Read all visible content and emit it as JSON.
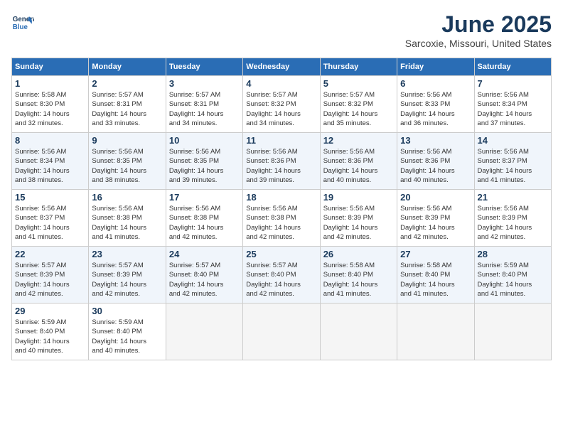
{
  "header": {
    "logo_line1": "General",
    "logo_line2": "Blue",
    "month": "June 2025",
    "location": "Sarcoxie, Missouri, United States"
  },
  "days_of_week": [
    "Sunday",
    "Monday",
    "Tuesday",
    "Wednesday",
    "Thursday",
    "Friday",
    "Saturday"
  ],
  "weeks": [
    [
      {
        "day": "1",
        "info": "Sunrise: 5:58 AM\nSunset: 8:30 PM\nDaylight: 14 hours\nand 32 minutes."
      },
      {
        "day": "2",
        "info": "Sunrise: 5:57 AM\nSunset: 8:31 PM\nDaylight: 14 hours\nand 33 minutes."
      },
      {
        "day": "3",
        "info": "Sunrise: 5:57 AM\nSunset: 8:31 PM\nDaylight: 14 hours\nand 34 minutes."
      },
      {
        "day": "4",
        "info": "Sunrise: 5:57 AM\nSunset: 8:32 PM\nDaylight: 14 hours\nand 34 minutes."
      },
      {
        "day": "5",
        "info": "Sunrise: 5:57 AM\nSunset: 8:32 PM\nDaylight: 14 hours\nand 35 minutes."
      },
      {
        "day": "6",
        "info": "Sunrise: 5:56 AM\nSunset: 8:33 PM\nDaylight: 14 hours\nand 36 minutes."
      },
      {
        "day": "7",
        "info": "Sunrise: 5:56 AM\nSunset: 8:34 PM\nDaylight: 14 hours\nand 37 minutes."
      }
    ],
    [
      {
        "day": "8",
        "info": "Sunrise: 5:56 AM\nSunset: 8:34 PM\nDaylight: 14 hours\nand 38 minutes."
      },
      {
        "day": "9",
        "info": "Sunrise: 5:56 AM\nSunset: 8:35 PM\nDaylight: 14 hours\nand 38 minutes."
      },
      {
        "day": "10",
        "info": "Sunrise: 5:56 AM\nSunset: 8:35 PM\nDaylight: 14 hours\nand 39 minutes."
      },
      {
        "day": "11",
        "info": "Sunrise: 5:56 AM\nSunset: 8:36 PM\nDaylight: 14 hours\nand 39 minutes."
      },
      {
        "day": "12",
        "info": "Sunrise: 5:56 AM\nSunset: 8:36 PM\nDaylight: 14 hours\nand 40 minutes."
      },
      {
        "day": "13",
        "info": "Sunrise: 5:56 AM\nSunset: 8:36 PM\nDaylight: 14 hours\nand 40 minutes."
      },
      {
        "day": "14",
        "info": "Sunrise: 5:56 AM\nSunset: 8:37 PM\nDaylight: 14 hours\nand 41 minutes."
      }
    ],
    [
      {
        "day": "15",
        "info": "Sunrise: 5:56 AM\nSunset: 8:37 PM\nDaylight: 14 hours\nand 41 minutes."
      },
      {
        "day": "16",
        "info": "Sunrise: 5:56 AM\nSunset: 8:38 PM\nDaylight: 14 hours\nand 41 minutes."
      },
      {
        "day": "17",
        "info": "Sunrise: 5:56 AM\nSunset: 8:38 PM\nDaylight: 14 hours\nand 42 minutes."
      },
      {
        "day": "18",
        "info": "Sunrise: 5:56 AM\nSunset: 8:38 PM\nDaylight: 14 hours\nand 42 minutes."
      },
      {
        "day": "19",
        "info": "Sunrise: 5:56 AM\nSunset: 8:39 PM\nDaylight: 14 hours\nand 42 minutes."
      },
      {
        "day": "20",
        "info": "Sunrise: 5:56 AM\nSunset: 8:39 PM\nDaylight: 14 hours\nand 42 minutes."
      },
      {
        "day": "21",
        "info": "Sunrise: 5:56 AM\nSunset: 8:39 PM\nDaylight: 14 hours\nand 42 minutes."
      }
    ],
    [
      {
        "day": "22",
        "info": "Sunrise: 5:57 AM\nSunset: 8:39 PM\nDaylight: 14 hours\nand 42 minutes."
      },
      {
        "day": "23",
        "info": "Sunrise: 5:57 AM\nSunset: 8:39 PM\nDaylight: 14 hours\nand 42 minutes."
      },
      {
        "day": "24",
        "info": "Sunrise: 5:57 AM\nSunset: 8:40 PM\nDaylight: 14 hours\nand 42 minutes."
      },
      {
        "day": "25",
        "info": "Sunrise: 5:57 AM\nSunset: 8:40 PM\nDaylight: 14 hours\nand 42 minutes."
      },
      {
        "day": "26",
        "info": "Sunrise: 5:58 AM\nSunset: 8:40 PM\nDaylight: 14 hours\nand 41 minutes."
      },
      {
        "day": "27",
        "info": "Sunrise: 5:58 AM\nSunset: 8:40 PM\nDaylight: 14 hours\nand 41 minutes."
      },
      {
        "day": "28",
        "info": "Sunrise: 5:59 AM\nSunset: 8:40 PM\nDaylight: 14 hours\nand 41 minutes."
      }
    ],
    [
      {
        "day": "29",
        "info": "Sunrise: 5:59 AM\nSunset: 8:40 PM\nDaylight: 14 hours\nand 40 minutes."
      },
      {
        "day": "30",
        "info": "Sunrise: 5:59 AM\nSunset: 8:40 PM\nDaylight: 14 hours\nand 40 minutes."
      },
      {
        "day": "",
        "info": ""
      },
      {
        "day": "",
        "info": ""
      },
      {
        "day": "",
        "info": ""
      },
      {
        "day": "",
        "info": ""
      },
      {
        "day": "",
        "info": ""
      }
    ]
  ]
}
